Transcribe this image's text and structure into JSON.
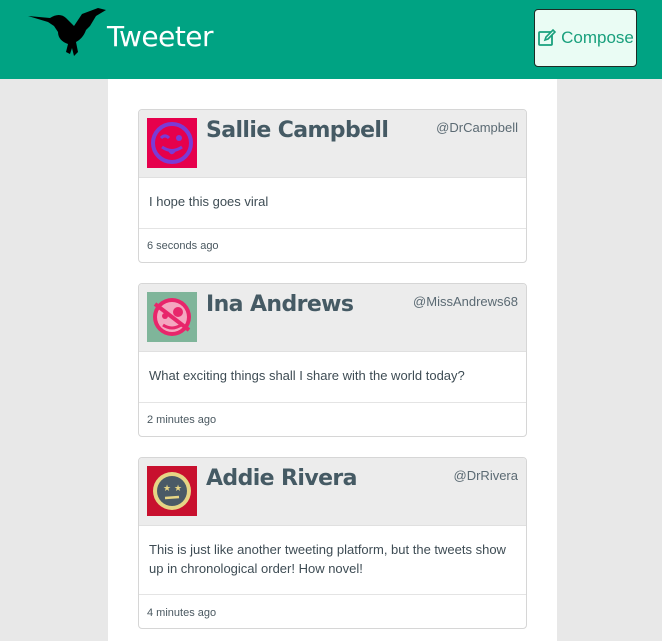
{
  "header": {
    "app_title": "Tweeter",
    "compose_label": "Compose",
    "brand_color": "#00a383"
  },
  "tweets": [
    {
      "name": "Sallie Campbell",
      "handle": "@DrCampbell",
      "text": "I hope this goes viral",
      "time": "6 seconds ago",
      "avatar_icon": "winking-face-tongue-avatar",
      "avatar_colors": [
        "#e6004c",
        "#7a3bd6"
      ]
    },
    {
      "name": "Ina Andrews",
      "handle": "@MissAndrews68",
      "text": "What exciting things shall I share with the world today?",
      "time": "2 minutes ago",
      "avatar_icon": "pirate-face-avatar",
      "avatar_colors": [
        "#7fb59a",
        "#e8266b"
      ]
    },
    {
      "name": "Addie Rivera",
      "handle": "@DrRivera",
      "text": "This is just like another tweeting platform, but the tweets show up in chronological order! How novel!",
      "time": "4 minutes ago",
      "avatar_icon": "star-eyes-face-avatar",
      "avatar_colors": [
        "#c8102e",
        "#e6d585"
      ]
    }
  ]
}
